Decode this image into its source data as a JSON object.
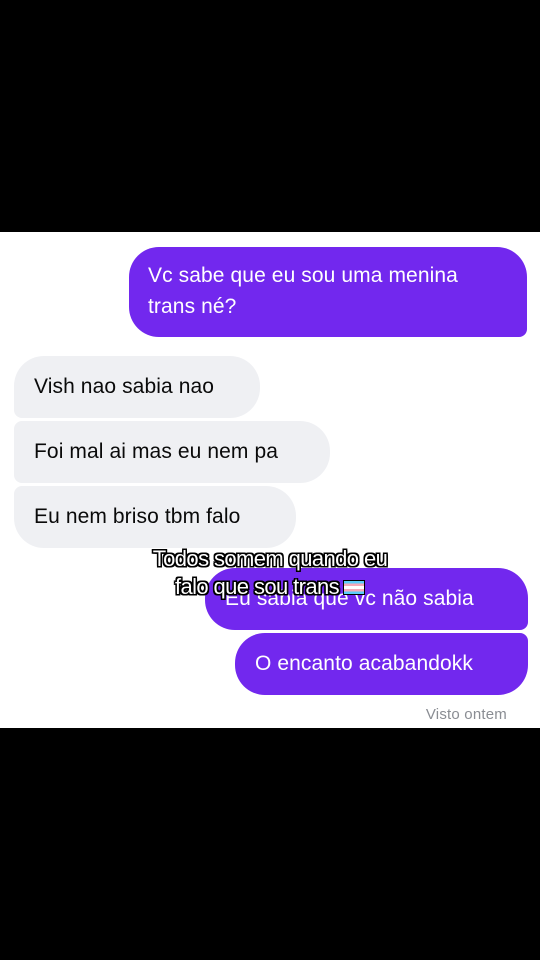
{
  "messages": [
    {
      "direction": "sent",
      "text": "Vc sabe que eu sou uma menina trans né?"
    },
    {
      "direction": "received",
      "text": "Vish nao sabia nao"
    },
    {
      "direction": "received",
      "text": "Foi mal ai mas eu nem pa"
    },
    {
      "direction": "received",
      "text": "Eu nem briso tbm falo"
    },
    {
      "direction": "sent",
      "text": "Eu sabia que vc não sabia"
    },
    {
      "direction": "sent",
      "text": "O encanto acabandokk"
    }
  ],
  "seen_status": "Visto ontem",
  "overlay_caption": {
    "line1": "Todos somem quando eu",
    "line2": "falo que sou trans",
    "icon": "transgender-flag-icon"
  },
  "colors": {
    "sent_bubble": "#7228ee",
    "received_bubble": "#eff0f3",
    "background": "#000000",
    "chat_panel": "#ffffff"
  }
}
